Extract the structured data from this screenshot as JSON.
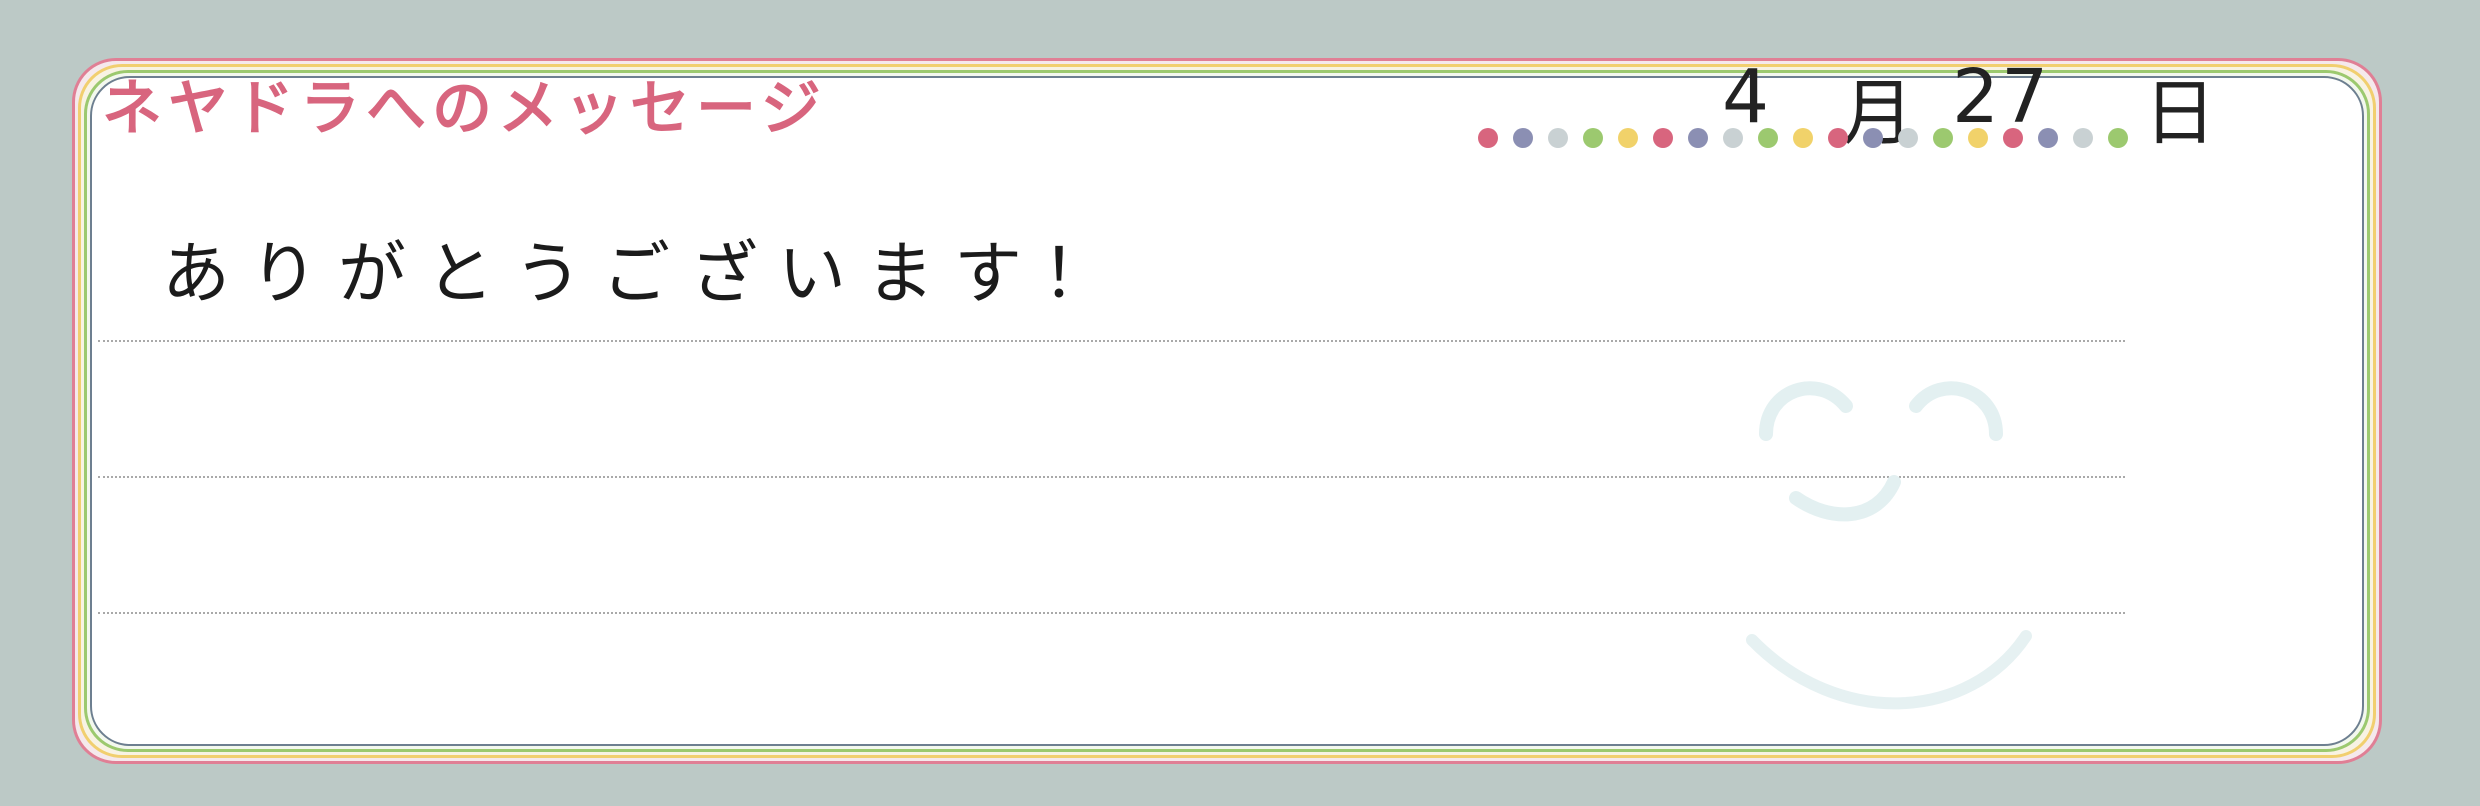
{
  "card": {
    "title": "ネヤドラへのメッセージ",
    "date": {
      "month": "4",
      "month_unit": "月",
      "day": "27",
      "day_unit": "日"
    },
    "message": "ありがとうございます！"
  },
  "decor": {
    "dot_colors": [
      "#d8657e",
      "#8b8fb3",
      "#c9d1d3",
      "#9cc96f",
      "#f1d26a",
      "#d8657e",
      "#8b8fb3",
      "#c9d1d3",
      "#9cc96f",
      "#f1d26a",
      "#d8657e",
      "#8b8fb3",
      "#c9d1d3",
      "#9cc96f",
      "#f1d26a",
      "#d8657e",
      "#8b8fb3",
      "#c9d1d3",
      "#9cc96f"
    ],
    "frame_colors": [
      "#e07f95",
      "#f1cf6f",
      "#9cc96f",
      "#6d7f90"
    ],
    "watermark": "smiley-face"
  }
}
